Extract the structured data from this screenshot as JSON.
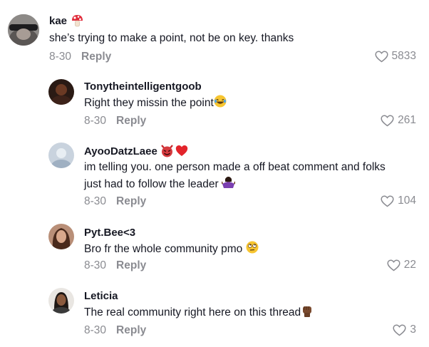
{
  "comments": [
    {
      "username": "kae",
      "username_emoji": "mushroom",
      "text": "she’s trying to make a point, not be on key. thanks",
      "date": "8-30",
      "reply_label": "Reply",
      "likes": "5833"
    },
    {
      "username": "Tonytheintelligentgoob",
      "text": "Right they missin the point",
      "text_emoji": "laughing-face",
      "date": "8-30",
      "reply_label": "Reply",
      "likes": "261"
    },
    {
      "username": "AyooDatzLaee",
      "username_emoji": "devil-and-heart",
      "text_line1": "im telling you. one person made a off beat comment and folks",
      "text_line2": "just had to follow the leader",
      "text_emoji": "person-shrugging",
      "date": "8-30",
      "reply_label": "Reply",
      "likes": "104"
    },
    {
      "username": "Pyt.Bee<3",
      "text": "Bro fr the whole community pmo",
      "text_emoji": "eye-roll-face",
      "date": "8-30",
      "reply_label": "Reply",
      "likes": "22"
    },
    {
      "username": "Leticia",
      "text": "The real community right here on this thread",
      "text_emoji": "raised-fist",
      "date": "8-30",
      "reply_label": "Reply",
      "likes": "3"
    }
  ]
}
